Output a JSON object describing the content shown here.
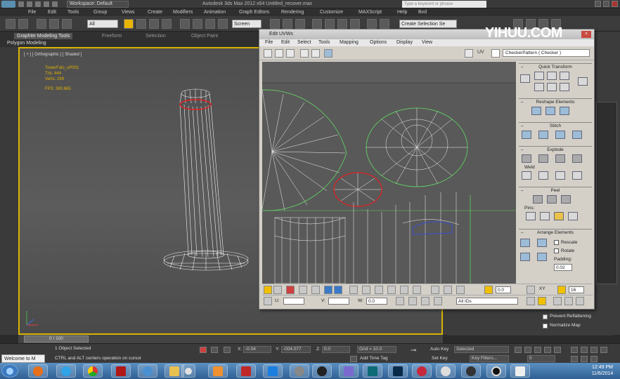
{
  "titlebar": {
    "workspace": "Workspace: Default",
    "title": "Autodesk 3ds Max 2012 x64      Untitled_recover.max",
    "search_placeholder": "Type a keyword or phrase"
  },
  "menu": [
    "File",
    "Edit",
    "Tools",
    "Group",
    "Views",
    "Create",
    "Modifiers",
    "Animation",
    "Graph Editors",
    "Rendering",
    "Customize",
    "MAXScript",
    "Help",
    "Bvd"
  ],
  "toolbar": {
    "filter_select": "All",
    "coord_select": "Screen",
    "named_selection": "Create Selection Se"
  },
  "ribbon": {
    "tabs": [
      "Graphite Modeling Tools",
      "Freeform",
      "Selection",
      "Object Paint"
    ],
    "sub_label": "Polygon Modeling"
  },
  "viewport": {
    "label": "[ + ] [ Orthographic ] [ Shaded ]",
    "stats": {
      "name": "TowerFalo_uP001",
      "tris_label": "Tris:",
      "tris": "444",
      "verts_label": "Verts:",
      "verts": "299",
      "fps_label": "FPS:",
      "fps": "380.665"
    }
  },
  "uvw": {
    "title": "Edit UVWs",
    "menu": [
      "File",
      "Edit",
      "Select",
      "Tools",
      "Mapping",
      "Options",
      "Display",
      "View"
    ],
    "uv_label": "UV",
    "checker": "CheckerPattern  ( Checker )",
    "sections": {
      "quick": "Quick Transform",
      "reshape": "Reshape Elements",
      "stitch": "Stitch",
      "explode": "Explode",
      "weld": "Weld",
      "peel": "Peel",
      "pins": "Pins:",
      "arrange": "Arrange Elements",
      "rescale": "Rescale",
      "rotate": "Rotate",
      "padding": "Padding:",
      "padding_value": "0.02"
    },
    "bottom": {
      "xy": "XY",
      "spin1": "0.0",
      "spin2": "16",
      "u_label": "U:",
      "v_label": "V:",
      "w_label": "W:",
      "w_value": "0.0",
      "all_ids": "All IDs"
    }
  },
  "cmdpanel": {
    "prevent_reflattening": "Prevent Reflattening",
    "normalize_map": "Normalize Map"
  },
  "timeline": {
    "slider": "0 / 100"
  },
  "status": {
    "selection": "1 Object Selected",
    "hint": "CTRL and ALT centers operation on cursor",
    "x_label": "X:",
    "x_value": "-0.04",
    "y_label": "Y:",
    "y_value": "-004.077",
    "z_label": "Z:",
    "z_value": "0.0",
    "grid": "Grid = 10.0",
    "add_time_tag": "Add Time Tag",
    "auto_key": "Auto Key",
    "set_key": "Set Key",
    "selected": "Selected",
    "key_filters": "Key Filters...",
    "frame": "0",
    "welcome": "Welcome to M"
  },
  "taskbar": {
    "time": "12:49 PM",
    "date": "11/6/2014"
  },
  "watermark": "YIHUU.COM"
}
